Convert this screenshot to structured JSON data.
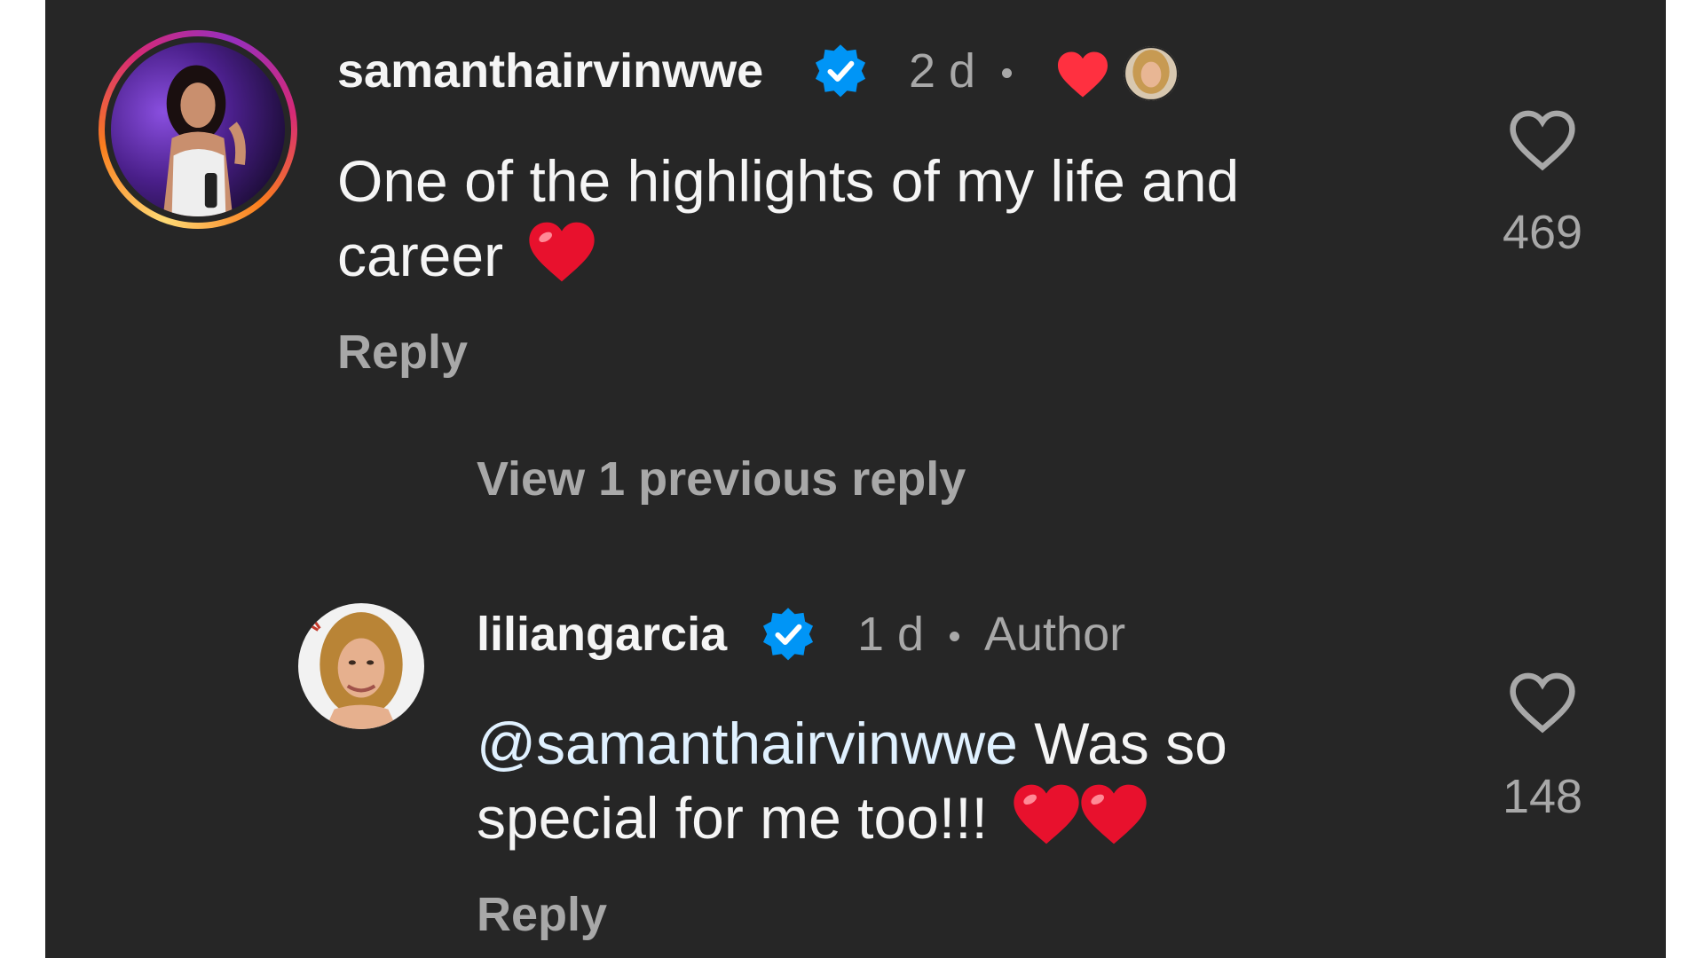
{
  "comments": [
    {
      "username": "samanthairvinwwe",
      "verified": true,
      "time": "2 d",
      "liked_by_author": true,
      "text_parts": [
        "One of the highlights of my life and",
        "career"
      ],
      "reply_label": "Reply",
      "like_count": "469"
    },
    {
      "username": "liliangarcia",
      "verified": true,
      "time": "1 d",
      "role": "Author",
      "mention": "@samanthairvinwwe",
      "text_rest": " Was so",
      "text_line2": "special for me too!!!",
      "reply_label": "Reply",
      "like_count": "148"
    }
  ],
  "thread": {
    "view_replies_label": "View 1 previous reply"
  },
  "colors": {
    "background": "#262626",
    "primary_text": "#f5f5f5",
    "secondary_text": "#a8a8a8",
    "verified_badge": "#0095f6",
    "heart": "#ff3040",
    "mention": "#e0f1ff"
  },
  "icons": {
    "verified": "verified-badge-icon",
    "like": "heart-outline-icon",
    "author_liked": "red-heart-icon",
    "emoji": "red-heart-emoji"
  }
}
